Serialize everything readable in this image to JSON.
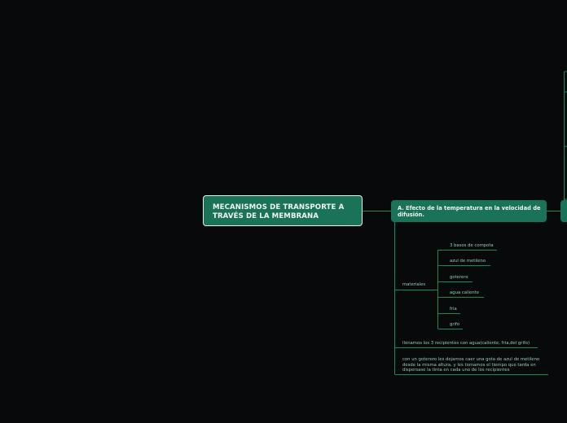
{
  "mindmap": {
    "root": {
      "label": "MECANISMOS DE TRANSPORTE A TRAVÉS DE LA MEMBRANA"
    },
    "topic": {
      "label": "A. Efecto de la temperatura en la velocidad de difusión."
    },
    "subtopics": {
      "materiales": {
        "label": "materiales",
        "items": [
          "3 basos de compota",
          "azul de metileno",
          "goterero",
          "agua caliente",
          "fria",
          "grifo"
        ]
      },
      "step1": "llenamos los 3 recipientes con agua(caliente, fria,del grifo)",
      "step2": "con un goterero les dejamos caer una gota de azul de metileno desde la misma altura, y les tomamos el tiempo que tarda en dispersase la tinta en cada uno de los recipientes"
    }
  },
  "colors": {
    "background": "#07090b",
    "node": "#1a7259",
    "line": "#178a55",
    "text_light": "#eef6f2",
    "text_sub": "#9ccab7"
  }
}
